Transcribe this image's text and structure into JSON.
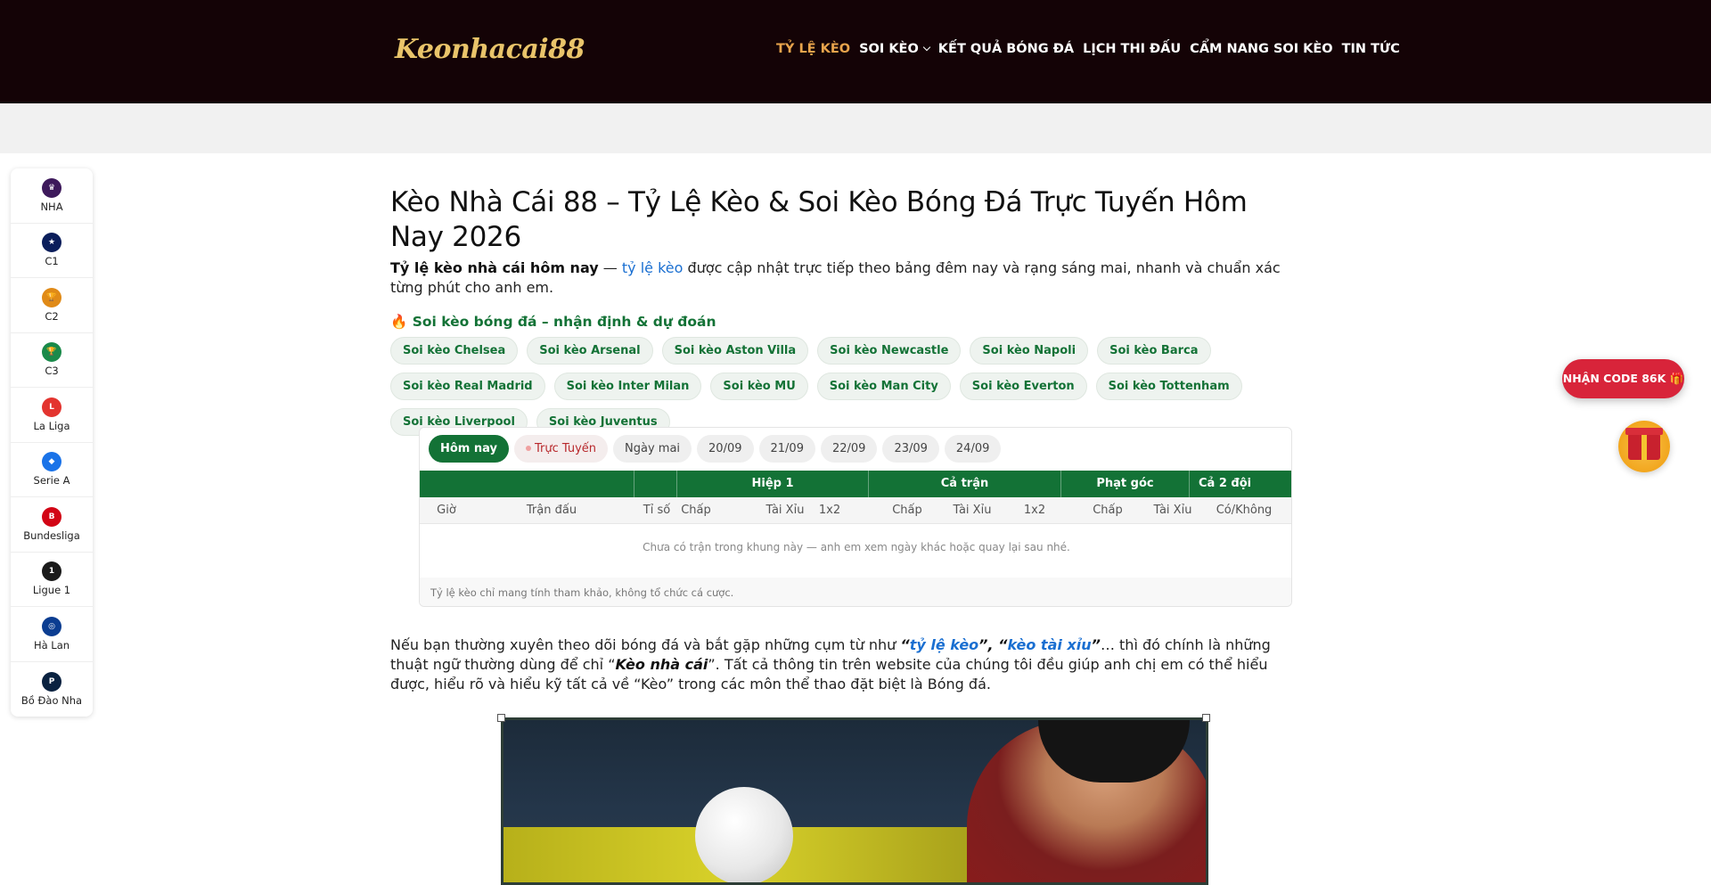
{
  "header": {
    "logo_text": "Keonhacai88",
    "nav": [
      {
        "label": "TỶ LỆ KÈO",
        "active": true
      },
      {
        "label": "SOI KÈO",
        "has_dropdown": true
      },
      {
        "label": "KẾT QUẢ BÓNG ĐÁ"
      },
      {
        "label": "LỊCH THI ĐẤU"
      },
      {
        "label": "CẨM NANG SOI KÈO"
      },
      {
        "label": "TIN TỨC"
      }
    ]
  },
  "sidebar": {
    "items": [
      {
        "label": "NHA",
        "icon": "premier-league-icon",
        "color": "#3d195b",
        "glyph": "♛"
      },
      {
        "label": "C1",
        "icon": "champions-league-icon",
        "color": "#0b1e5b",
        "glyph": "★"
      },
      {
        "label": "C2",
        "icon": "europa-league-icon",
        "color": "#e08a17",
        "glyph": "🏆"
      },
      {
        "label": "C3",
        "icon": "conference-league-icon",
        "color": "#1a8a4a",
        "glyph": "🏆"
      },
      {
        "label": "La Liga",
        "icon": "laliga-icon",
        "color": "#e3342f",
        "glyph": "L"
      },
      {
        "label": "Serie A",
        "icon": "serie-a-icon",
        "color": "#1a73e8",
        "glyph": "◆"
      },
      {
        "label": "Bundesliga",
        "icon": "bundesliga-icon",
        "color": "#d20515",
        "glyph": "B"
      },
      {
        "label": "Ligue 1",
        "icon": "ligue1-icon",
        "color": "#1b1b1b",
        "glyph": "1"
      },
      {
        "label": "Hà Lan",
        "icon": "eredivisie-icon",
        "color": "#0b3d91",
        "glyph": "◎"
      },
      {
        "label": "Bồ Đào Nha",
        "icon": "liga-portugal-icon",
        "color": "#0a2240",
        "glyph": "P"
      }
    ]
  },
  "main": {
    "title": "Kèo Nhà Cái 88 – Tỷ Lệ Kèo & Soi Kèo Bóng Đá Trực Tuyến Hôm Nay 2026",
    "intro_bold": "Tỷ lệ kèo nhà cái hôm nay",
    "intro_dash": " — ",
    "intro_link": "tỷ lệ kèo",
    "intro_rest": " được cập nhật trực tiếp theo bảng đêm nay và rạng sáng mai, nhanh và chuẩn xác từng phút cho anh em.",
    "section_heading": "🔥 Soi kèo bóng đá – nhận định & dự đoán",
    "chips": [
      "Soi kèo Chelsea",
      "Soi kèo Arsenal",
      "Soi kèo Aston Villa",
      "Soi kèo Newcastle",
      "Soi kèo Napoli",
      "Soi kèo Barca",
      "Soi kèo Real Madrid",
      "Soi kèo Inter Milan",
      "Soi kèo MU",
      "Soi kèo Man City",
      "Soi kèo Everton",
      "Soi kèo Tottenham",
      "Soi kèo Liverpool",
      "Soi kèo Juventus"
    ]
  },
  "odds_table": {
    "tabs": [
      "Hôm nay",
      "Trực Tuyến",
      "Ngày mai",
      "20/09",
      "21/09",
      "22/09",
      "23/09",
      "24/09"
    ],
    "group_headers": [
      "Hiệp 1",
      "Cả trận",
      "Phạt góc",
      "Cả 2 đội"
    ],
    "columns": [
      "Giờ",
      "Trận đấu",
      "Tỉ số",
      "Chấp",
      "Tài Xỉu",
      "1x2",
      "Chấp",
      "Tài Xỉu",
      "1x2",
      "Chấp",
      "Tài Xỉu",
      "Có/Không"
    ],
    "empty_message": "Chưa có trận trong khung này — anh em xem ngày khác hoặc quay lại sau nhé.",
    "note": "Tỷ lệ kèo chỉ mang tính tham khảo, không tổ chức cá cược."
  },
  "article": {
    "p1_a": "Nếu bạn thường xuyên theo dõi bóng đá và bắt gặp những cụm từ như ",
    "q1_open": "“",
    "q1_link": "tỷ lệ kèo",
    "q1_close": "”, “",
    "q2_link": "kèo tài xỉu",
    "q2_close": "”",
    "p1_b": "… thì đó chính là những thuật ngữ thường dùng để chỉ “",
    "term": "Kèo nhà cái",
    "p1_c": "”. Tất cả thông tin trên website của chúng tôi đều giúp anh chị em có thể hiểu được, hiểu rõ và hiểu kỹ tất cả về “Kèo” trong các môn thể thao đặt biệt là Bóng đá."
  },
  "promo": {
    "label": "NHẬN CODE 86K 🎁"
  },
  "colors": {
    "header_bg": "#140306",
    "accent_green": "#137236",
    "nav_active": "#e8a44c",
    "promo_red": "#d8243a",
    "link_blue": "#1a6fd1"
  }
}
